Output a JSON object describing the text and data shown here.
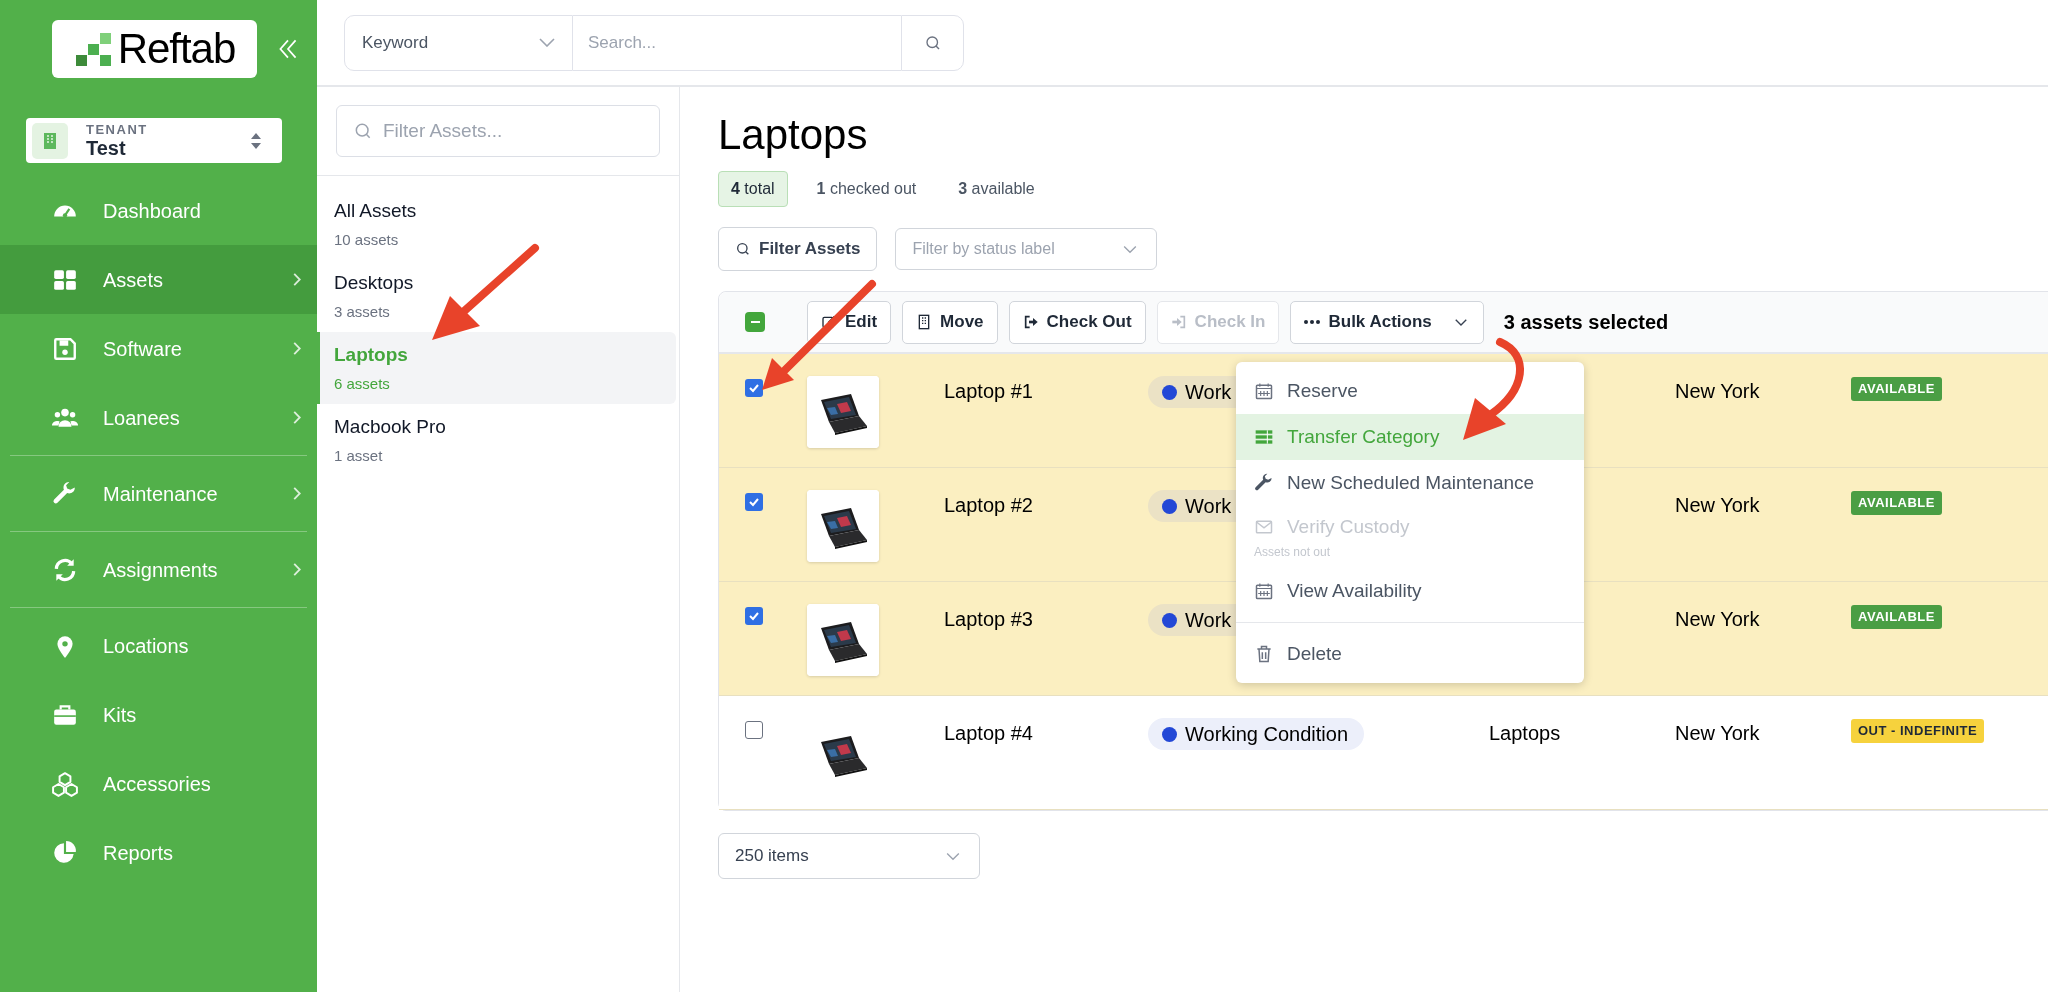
{
  "sidebar": {
    "logo": "Reftab",
    "tenant": {
      "label": "TENANT",
      "value": "Test"
    },
    "sections": [
      [
        {
          "label": "Dashboard",
          "selected": false,
          "submenu": false
        },
        {
          "label": "Assets",
          "selected": true,
          "submenu": true
        },
        {
          "label": "Software",
          "selected": false,
          "submenu": true
        },
        {
          "label": "Loanees",
          "selected": false,
          "submenu": true
        }
      ],
      [
        {
          "label": "Maintenance",
          "selected": false,
          "submenu": true
        }
      ],
      [
        {
          "label": "Assignments",
          "selected": false,
          "submenu": true
        }
      ],
      [
        {
          "label": "Locations",
          "selected": false,
          "submenu": false
        },
        {
          "label": "Kits",
          "selected": false,
          "submenu": false
        },
        {
          "label": "Accessories",
          "selected": false,
          "submenu": false
        },
        {
          "label": "Reports",
          "selected": false,
          "submenu": false
        }
      ]
    ]
  },
  "search": {
    "scope": "Keyword",
    "placeholder": "Search..."
  },
  "categories": {
    "filter_placeholder": "Filter Assets...",
    "items": [
      {
        "name": "All Assets",
        "count": "10 assets",
        "selected": false
      },
      {
        "name": "Desktops",
        "count": "3 assets",
        "selected": false
      },
      {
        "name": "Laptops",
        "count": "6 assets",
        "selected": true
      },
      {
        "name": "Macbook Pro",
        "count": "1 asset",
        "selected": false
      }
    ]
  },
  "main": {
    "title": "Laptops",
    "stats": [
      {
        "text": "**4** total",
        "selected": true
      },
      {
        "text": "**1** checked out",
        "selected": false
      },
      {
        "text": "**3** available",
        "selected": false
      }
    ],
    "filter_button": "Filter Assets",
    "status_filter": {
      "placeholder": "Filter by status label"
    },
    "toolbar": {
      "select_all_indeterminate": true,
      "buttons": [
        {
          "label": "Edit",
          "disabled": false
        },
        {
          "label": "Move",
          "disabled": false
        },
        {
          "label": "Check Out",
          "disabled": false
        },
        {
          "label": "Check In",
          "disabled": true
        }
      ],
      "bulk_actions": "Bulk Actions",
      "selection": "3 assets selected"
    },
    "rows": [
      {
        "checked": true,
        "name": "Laptop #1",
        "status": "Work",
        "location": "New York",
        "badge": {
          "label": "AVAILABLE",
          "color": "#4a9e44"
        }
      },
      {
        "checked": true,
        "name": "Laptop #2",
        "status": "Work",
        "location": "New York",
        "badge": {
          "label": "AVAILABLE",
          "color": "#4a9e44"
        }
      },
      {
        "checked": true,
        "name": "Laptop #3",
        "status": "Work",
        "location": "New York",
        "badge": {
          "label": "AVAILABLE",
          "color": "#4a9e44"
        }
      },
      {
        "checked": false,
        "name": "Laptop #4",
        "status": "Working Condition",
        "category": "Laptops",
        "location": "New York",
        "badge": {
          "label": "OUT - INDEFINITE",
          "color": "#f6d23d"
        }
      }
    ],
    "menu": {
      "sections": [
        [
          {
            "label": "Reserve",
            "selected": false,
            "disabled": false
          },
          {
            "label": "Transfer Category",
            "selected": true,
            "disabled": false
          },
          {
            "label": "New Scheduled Maintenance",
            "selected": false,
            "disabled": false
          },
          {
            "label": "Verify Custody",
            "note": "Assets not out",
            "selected": false,
            "disabled": true
          },
          {
            "label": "View Availability",
            "selected": false,
            "disabled": false
          }
        ],
        [
          {
            "label": "Delete",
            "selected": false,
            "disabled": false
          }
        ]
      ]
    },
    "page_size": "250 items"
  }
}
